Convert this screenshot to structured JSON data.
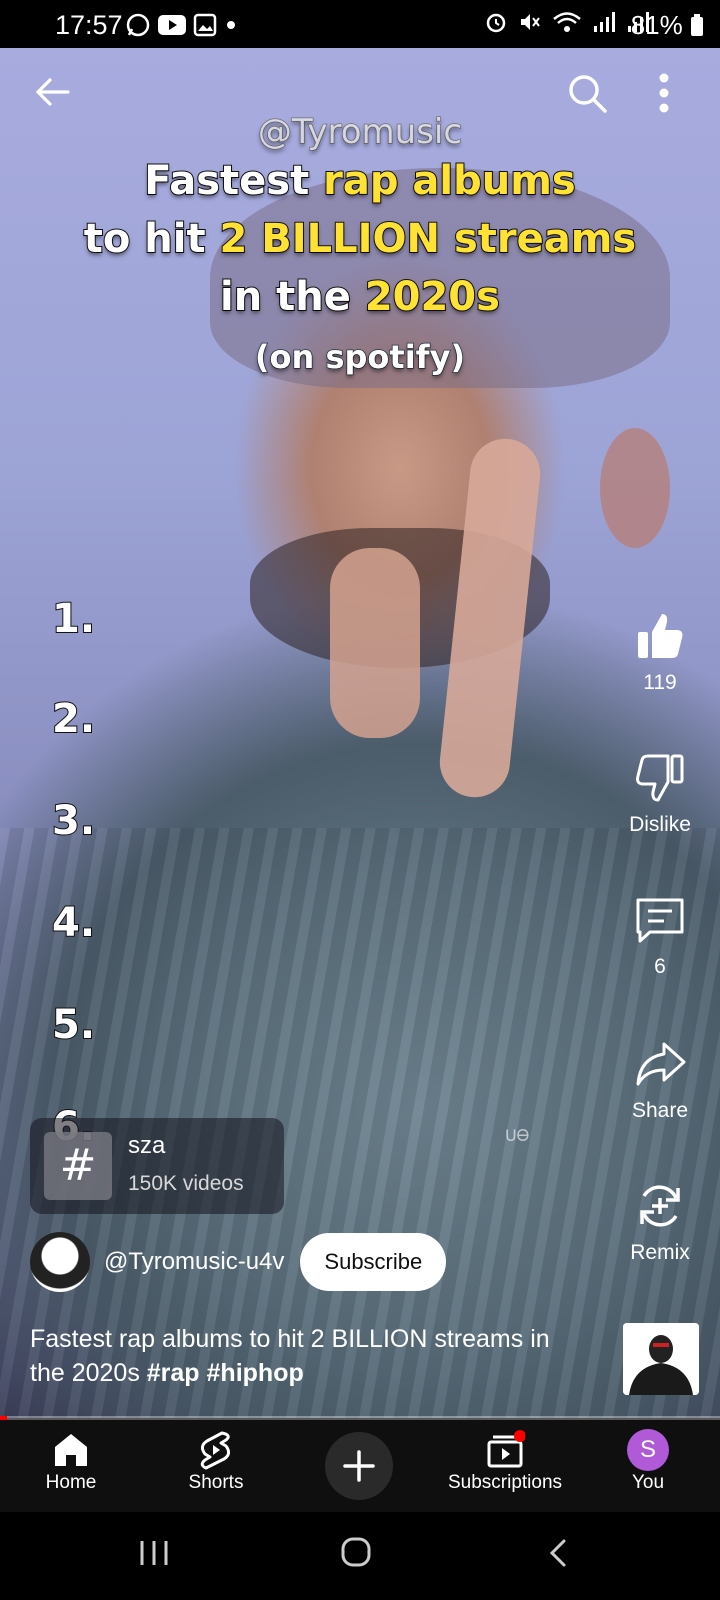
{
  "status_bar": {
    "time": "17:57",
    "battery": "81%"
  },
  "video": {
    "overlay": {
      "handle": "@Tyromusic",
      "line1_white": "Fastest ",
      "line1_yellow": "rap albums",
      "line2_white": "to hit ",
      "line2_yellow": "2 BILLION streams",
      "line3_white": "in the ",
      "line3_yellow": "2020s",
      "subtitle": "(on spotify)"
    },
    "ranks": [
      "1.",
      "2.",
      "3.",
      "4.",
      "5.",
      "6."
    ],
    "watermark": "ᑌᎾ"
  },
  "actions": {
    "like_count": "119",
    "dislike_label": "Dislike",
    "comment_count": "6",
    "share_label": "Share",
    "remix_label": "Remix"
  },
  "topic": {
    "symbol": "#",
    "name": "sza",
    "count": "150K videos"
  },
  "channel": {
    "handle": "@Tyromusic-u4v",
    "subscribe_label": "Subscribe"
  },
  "caption": {
    "text": "Fastest rap albums to hit 2 BILLION streams in the 2020s ",
    "tag1": "#rap",
    "tag2": "#hiphop"
  },
  "progress": {
    "fraction": 0.01
  },
  "bottom_nav": {
    "home": "Home",
    "shorts": "Shorts",
    "subscriptions": "Subscriptions",
    "you": "You",
    "you_initial": "S"
  },
  "colors": {
    "highlight_yellow": "#ffe233",
    "progress_red": "#ff0000",
    "you_avatar": "#b05ad8"
  }
}
